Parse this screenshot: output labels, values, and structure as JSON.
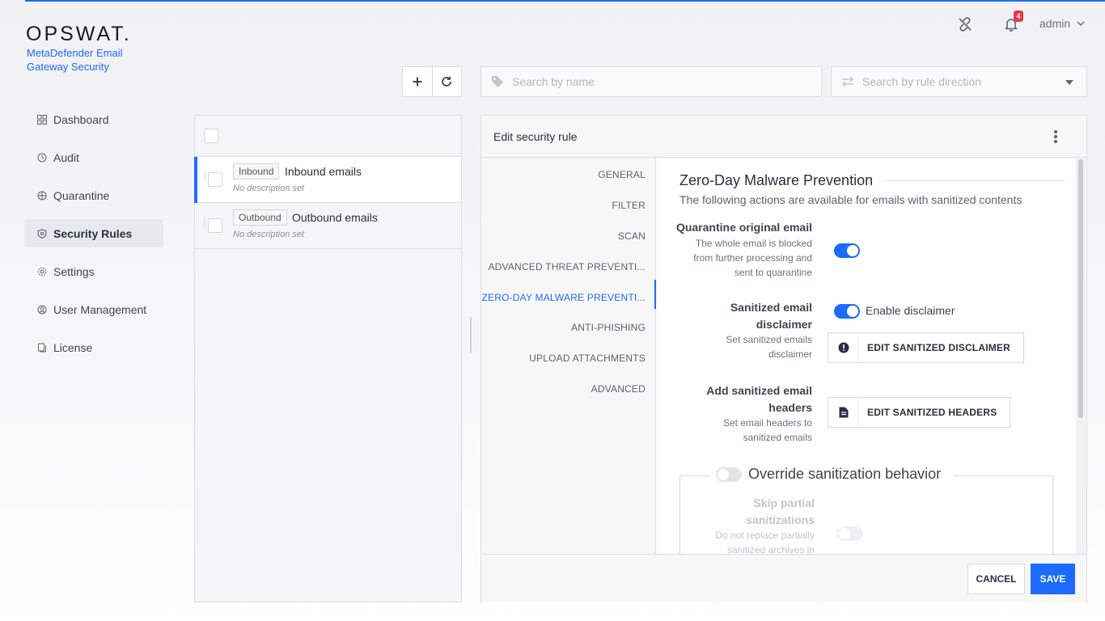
{
  "brand": {
    "logo_text": "OPSWAT.",
    "product": "MetaDefender Email Gateway Security"
  },
  "header": {
    "notifications_count": "4",
    "user": "admin",
    "icons": [
      "unlink-icon",
      "bell-icon",
      "chevron-down-icon"
    ]
  },
  "nav": {
    "items": [
      {
        "label": "Dashboard",
        "icon": "grid-icon"
      },
      {
        "label": "Audit",
        "icon": "audit-icon"
      },
      {
        "label": "Quarantine",
        "icon": "quarantine-icon"
      },
      {
        "label": "Security Rules",
        "icon": "shield-icon",
        "active": true
      },
      {
        "label": "Settings",
        "icon": "gear-icon"
      },
      {
        "label": "User Management",
        "icon": "user-icon"
      },
      {
        "label": "License",
        "icon": "license-icon"
      }
    ]
  },
  "toolbar": {
    "search_name_placeholder": "Search by name",
    "search_direction_placeholder": "Search by rule direction"
  },
  "rules": [
    {
      "tag": "Inbound",
      "name": "Inbound emails",
      "desc": "No description set",
      "selected": true
    },
    {
      "tag": "Outbound",
      "name": "Outbound emails",
      "desc": "No description set",
      "selected": false
    }
  ],
  "editor": {
    "title": "Edit security rule",
    "tabs": [
      "GENERAL",
      "FILTER",
      "SCAN",
      "ADVANCED THREAT PREVENTI...",
      "ZERO-DAY MALWARE PREVENTI...",
      "ANTI-PHISHING",
      "UPLOAD ATTACHMENTS",
      "ADVANCED"
    ],
    "active_tab": "ZERO-DAY MALWARE PREVENTI...",
    "section_title": "Zero-Day Malware Prevention",
    "section_subtitle": "The following actions are available for emails with sanitized contents",
    "quarantine": {
      "label": "Quarantine original email",
      "desc": "The whole email is blocked from further processing and sent to quarantine",
      "enabled": true
    },
    "disclaimer": {
      "label": "Sanitized email disclaimer",
      "desc": "Set sanitized emails disclaimer",
      "toggle_label": "Enable disclaimer",
      "enabled": true,
      "button": "EDIT SANITIZED DISCLAIMER"
    },
    "headers": {
      "label": "Add sanitized email headers",
      "desc": "Set email headers to sanitized emails",
      "button": "EDIT SANITIZED HEADERS"
    },
    "override": {
      "label": "Override sanitization behavior",
      "enabled": false,
      "skip_label": "Skip partial sanitizations",
      "skip_desc": "Do not replace partially sanitized archives in"
    },
    "cancel": "CANCEL",
    "save": "SAVE"
  },
  "colors": {
    "accent": "#1d6bfc",
    "badge": "#e4394f"
  }
}
